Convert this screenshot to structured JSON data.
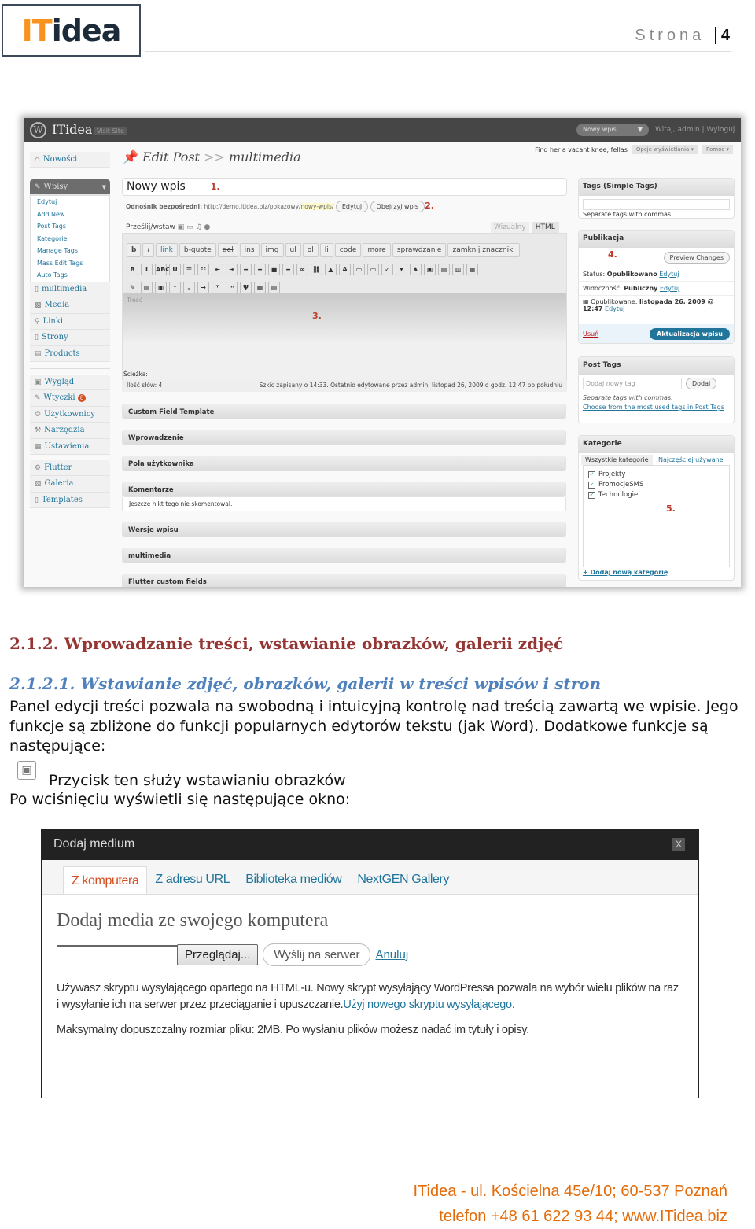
{
  "header": {
    "logo_it": "IT",
    "logo_idea": "idea",
    "page_label": "Strona",
    "page_number": "4"
  },
  "wp": {
    "site_name": "ITidea",
    "visit_site": "Visit Site",
    "favorite": "Nowy wpis",
    "greeting": "Witaj, admin | Wyloguj",
    "tagline": "Find her a vacant knee, fellas",
    "screen_options": "Opcje wyświetlania ▾",
    "help": "Pomoc ▾",
    "page_title": "Edit Post",
    "page_title_sep": ">>",
    "page_title_sub": "multimedia",
    "sidebar": {
      "dashboard": "Nowości",
      "posts": "Wpisy",
      "posts_sub": [
        "Edytuj",
        "Add New",
        "Post Tags",
        "Kategorie",
        "Manage Tags",
        "Mass Edit Tags",
        "Auto Tags"
      ],
      "group1": [
        "multimedia",
        "Media",
        "Linki",
        "Strony",
        "Products"
      ],
      "group2": [
        "Wygląd",
        "Wtyczki",
        "Użytkownicy",
        "Narzędzia",
        "Ustawienia"
      ],
      "plugins_badge": "8",
      "group3": [
        "Flutter",
        "Galeria",
        "Templates"
      ]
    },
    "post_title": "Nowy wpis",
    "marker1": "1.",
    "marker2": "2.",
    "marker3": "3.",
    "marker4": "4.",
    "marker5": "5.",
    "permalink_label": "Odnośnik bezpośredni:",
    "permalink_base": "http://demo.itidea.biz/pokazowy/",
    "permalink_slug": "nowy-wpis/",
    "edit_btn": "Edytuj",
    "view_btn": "Obejrzyj wpis",
    "upload_label": "Prześlij/wstaw",
    "tab_visual": "Wizualny",
    "tab_html": "HTML",
    "quicktags": [
      "b",
      "i",
      "link",
      "b-quote",
      "del",
      "ins",
      "img",
      "ul",
      "ol",
      "li",
      "code",
      "more",
      "sprawdzanie",
      "zamknij znaczniki"
    ],
    "content_placeholder": "Treść",
    "path_label": "Ścieżka:",
    "word_count": "Ilość słów: 4",
    "autosave": "Szkic zapisany o 14:33. Ostatnio edytowane przez admin, listopad 26, 2009 o godz. 12:47 po południu",
    "postboxes": [
      "Custom Field Template",
      "Wprowadzenie",
      "Pola użytkownika",
      "Komentarze",
      "Wersje wpisu",
      "multimedia",
      "Flutter custom fields"
    ],
    "comments_body": "Jeszcze nikt tego nie skomentował.",
    "simple_tags": {
      "title": "Tags (Simple Tags)",
      "hint": "Separate tags with commas"
    },
    "publish": {
      "title": "Publikacja",
      "preview": "Preview Changes",
      "status_label": "Status:",
      "status": "Opublikowano",
      "edit": "Edytuj",
      "visibility_label": "Widoczność:",
      "visibility": "Publiczny",
      "published_label": "Opublikowane:",
      "published": "listopada 26, 2009 @ 12:47",
      "delete": "Usuń",
      "update": "Aktualizacja wpisu"
    },
    "post_tags": {
      "title": "Post Tags",
      "placeholder": "Dodaj nowy tag",
      "add": "Dodaj",
      "hint": "Separate tags with commas.",
      "choose": "Choose from the most used tags in Post Tags"
    },
    "categories": {
      "title": "Kategorie",
      "tab_all": "Wszystkie kategorie",
      "tab_popular": "Najczęściej używane",
      "items": [
        "Projekty",
        "PromocjeSMS",
        "Technologie"
      ],
      "add": "+ Dodaj nową kategorię"
    }
  },
  "section": {
    "heading": "2.1.2. Wprowadzanie treści, wstawianie obrazków, galerii zdjęć",
    "subheading": "2.1.2.1. Wstawianie zdjęć, obrazków, galerii  w treści wpisów i stron",
    "para1": "Panel edycji treści pozwala na swobodną i intuicyjną kontrolę nad treścią zawartą we wpisie. Jego funkcje są zbliżone do funkcji popularnych edytorów tekstu (jak Word). Dodatkowe funkcje są następujące:",
    "icon_caption": "Przycisk ten służy wstawianiu obrazków",
    "para2": "Po wciśnięciu wyświetli się następujące okno:"
  },
  "dialog": {
    "title": "Dodaj medium",
    "close": "X",
    "tabs": [
      "Z komputera",
      "Z adresu URL",
      "Biblioteka mediów",
      "NextGEN Gallery"
    ],
    "heading": "Dodaj media ze swojego komputera",
    "browse": "Przeglądaj...",
    "upload": "Wyślij na serwer",
    "cancel": "Anuluj",
    "info": "Używasz skryptu wysyłającego opartego na HTML-u. Nowy skrypt wysyłający WordPressa pozwala na wybór wielu plików na raz i wysyłanie ich na serwer przez przeciąganie i upuszczanie.",
    "info_link": "Użyj nowego skryptu wysyłającego.",
    "max_size": "Maksymalny dopuszczalny rozmiar pliku: 2MB. Po wysłaniu plików możesz nadać im tytuły i opisy."
  },
  "footer": {
    "line1": "ITidea - ul. Kościelna 45e/10;  60-537 Poznań",
    "line2": "telefon +48 61 622 93 44; www.ITidea.biz"
  },
  "colors": {
    "brand_orange": "#f7931e",
    "heading": "#943634",
    "subheading": "#4f81bd",
    "footer": "#e36c0a",
    "wp_link": "#21759b"
  }
}
